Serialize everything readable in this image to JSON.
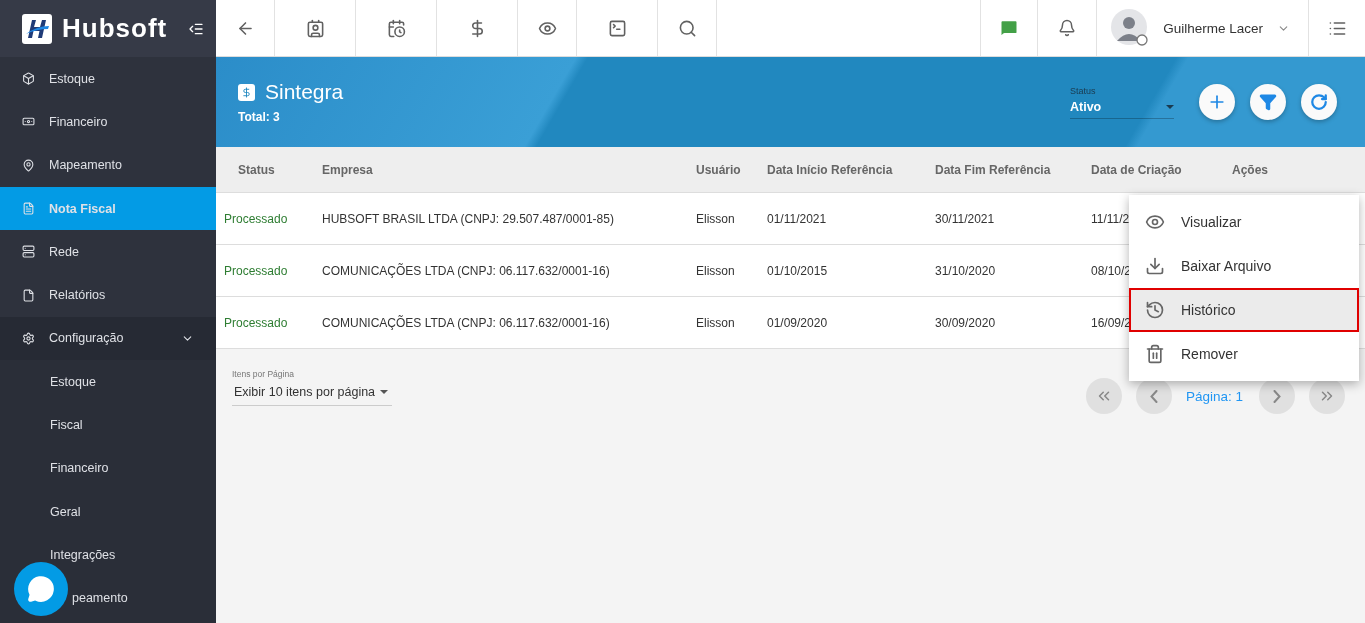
{
  "sidebar": {
    "logo": "Hubsoft",
    "items": [
      {
        "label": "Estoque",
        "selected": false
      },
      {
        "label": "Financeiro",
        "selected": false
      },
      {
        "label": "Mapeamento",
        "selected": false
      },
      {
        "label": "Nota Fiscal",
        "selected": true
      },
      {
        "label": "Rede",
        "selected": false
      },
      {
        "label": "Relatórios",
        "selected": false
      },
      {
        "label": "Configuração",
        "selected": false,
        "expanded": true,
        "children": [
          {
            "label": "Estoque"
          },
          {
            "label": "Fiscal"
          },
          {
            "label": "Financeiro"
          },
          {
            "label": "Geral"
          },
          {
            "label": "Integrações"
          },
          {
            "label": "peamento"
          }
        ]
      }
    ]
  },
  "topbar": {
    "user": "Guilherme Lacer"
  },
  "header": {
    "title": "Sintegra",
    "total": "Total: 3",
    "status_label": "Status",
    "status_value": "Ativo"
  },
  "table": {
    "columns": [
      "Status",
      "Empresa",
      "Usuário",
      "Data Início Referência",
      "Data Fim Referência",
      "Data de Criação",
      "Ações"
    ],
    "rows": [
      {
        "status": "Processado",
        "empresa": "HUBSOFT BRASIL LTDA (CNPJ: 29.507.487/0001-85)",
        "usuario": "Elisson",
        "inicio": "01/11/2021",
        "fim": "30/11/2021",
        "criacao": "11/11/2"
      },
      {
        "status": "Processado",
        "empresa": "COMUNICAÇÕES LTDA (CNPJ: 06.117.632/0001-16)",
        "usuario": "Elisson",
        "inicio": "01/10/2015",
        "fim": "31/10/2020",
        "criacao": "08/10/2"
      },
      {
        "status": "Processado",
        "empresa": "COMUNICAÇÕES LTDA (CNPJ: 06.117.632/0001-16)",
        "usuario": "Elisson",
        "inicio": "01/09/2020",
        "fim": "30/09/2020",
        "criacao": "16/09/2"
      }
    ]
  },
  "pagination": {
    "per_page_label": "Itens por Página",
    "per_page_value": "Exibir 10 itens por página",
    "page": "Página: 1"
  },
  "menu": [
    {
      "label": "Visualizar",
      "selected": false
    },
    {
      "label": "Baixar Arquivo",
      "selected": false
    },
    {
      "label": "Histórico",
      "selected": true
    },
    {
      "label": "Remover",
      "selected": false
    }
  ]
}
